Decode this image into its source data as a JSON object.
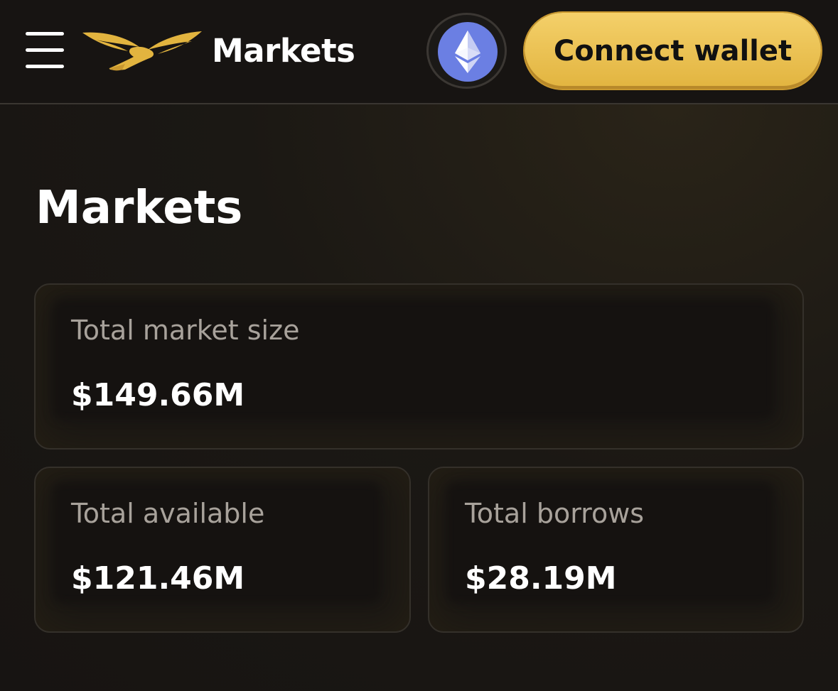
{
  "header": {
    "brand_title": "Markets",
    "network_icon": "ethereum-icon",
    "connect_label": "Connect wallet"
  },
  "main": {
    "title": "Markets",
    "stats": {
      "market_size": {
        "label": "Total market size",
        "value": "$149.66M"
      },
      "available": {
        "label": "Total available",
        "value": "$121.46M"
      },
      "borrows": {
        "label": "Total borrows",
        "value": "$28.19M"
      }
    }
  },
  "colors": {
    "background": "#171412",
    "accent_gold": "#e8bc4a",
    "ethereum_blue": "#6b7fe3",
    "label_gray": "#a8a29b"
  }
}
